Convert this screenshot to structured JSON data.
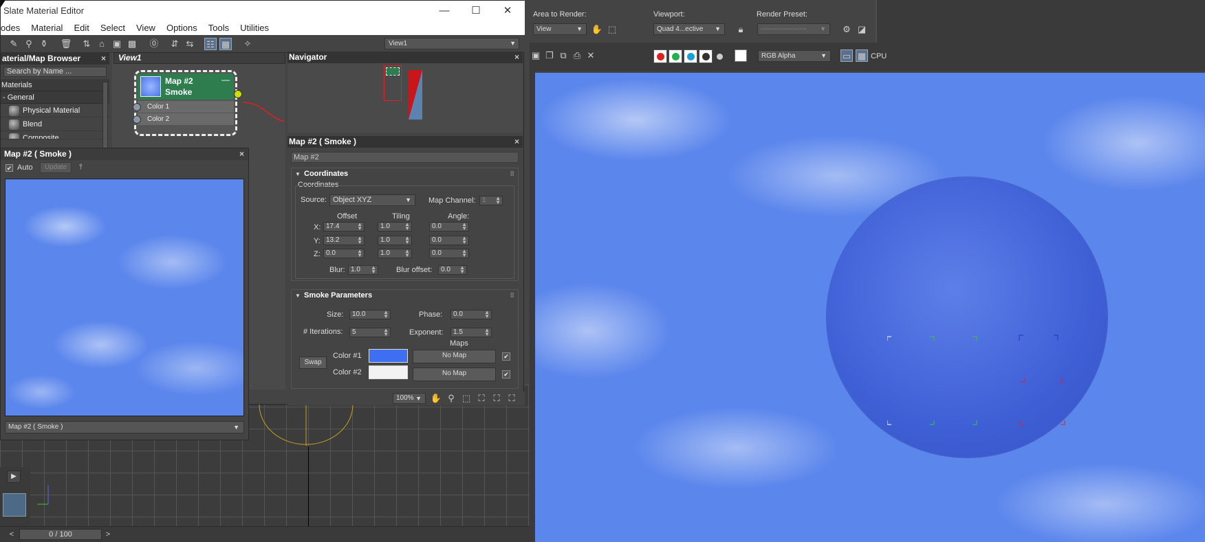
{
  "window": {
    "title": "Slate Material Editor",
    "minimize": "—",
    "maximize": "☐",
    "close": "✕"
  },
  "menu": [
    "odes",
    "Material",
    "Edit",
    "Select",
    "View",
    "Options",
    "Tools",
    "Utilities"
  ],
  "view_select": "View1",
  "browser": {
    "title": "aterial/Map Browser",
    "close": "×",
    "search_placeholder": "Search by Name ...",
    "section_materials": "Materials",
    "section_general": "- General",
    "items": [
      "Physical Material",
      "Blend",
      "Composite"
    ]
  },
  "view1_tab": "View1",
  "node": {
    "title_1": "Map #2",
    "title_2": "Smoke",
    "ports": [
      "Color 1",
      "Color 2"
    ],
    "minimize": "—"
  },
  "preview": {
    "title": "Map #2  ( Smoke )",
    "close": "×",
    "auto_check": "✔",
    "auto_label": "Auto",
    "update_label": "Update",
    "select_value": "Map #2  ( Smoke )"
  },
  "navigator": {
    "title": "Navigator",
    "close": "×"
  },
  "params": {
    "title": "Map #2  ( Smoke )",
    "close": "×",
    "name": "Map #2",
    "coords": {
      "header": "Coordinates",
      "group": "Coordinates",
      "source_label": "Source:",
      "source_value": "Object XYZ",
      "map_channel_label": "Map Channel:",
      "map_channel_value": "1",
      "col_offset": "Offset",
      "col_tiling": "Tiling",
      "col_angle": "Angle:",
      "rows": [
        {
          "axis": "X:",
          "offset": "17.4",
          "tiling": "1.0",
          "angle": "0.0"
        },
        {
          "axis": "Y:",
          "offset": "13.2",
          "tiling": "1.0",
          "angle": "0.0"
        },
        {
          "axis": "Z:",
          "offset": "0.0",
          "tiling": "1.0",
          "angle": "0.0"
        }
      ],
      "blur_label": "Blur:",
      "blur_value": "1.0",
      "blur_offset_label": "Blur offset:",
      "blur_offset_value": "0.0"
    },
    "smoke": {
      "header": "Smoke Parameters",
      "size_label": "Size:",
      "size_value": "10.0",
      "phase_label": "Phase:",
      "phase_value": "0.0",
      "iter_label": "# Iterations:",
      "iter_value": "5",
      "exp_label": "Exponent:",
      "exp_value": "1.5",
      "maps_label": "Maps",
      "swap_label": "Swap",
      "color1_label": "Color #1",
      "color1": "#3e6ff2",
      "color2_label": "Color #2",
      "color2": "#f2f2f2",
      "no_map": "No Map",
      "check": "✔"
    },
    "zoom": "100%"
  },
  "render": {
    "area_label": "Area to Render:",
    "area_value": "View",
    "viewport_label": "Viewport:",
    "viewport_value": "Quad 4...ective",
    "preset_label": "Render Preset:",
    "preset_value": "--------------------",
    "channel_value": "RGB Alpha",
    "cpu_label": "CPU"
  },
  "timeline": {
    "value": "0 / 100",
    "prev": "<",
    "next": ">"
  }
}
